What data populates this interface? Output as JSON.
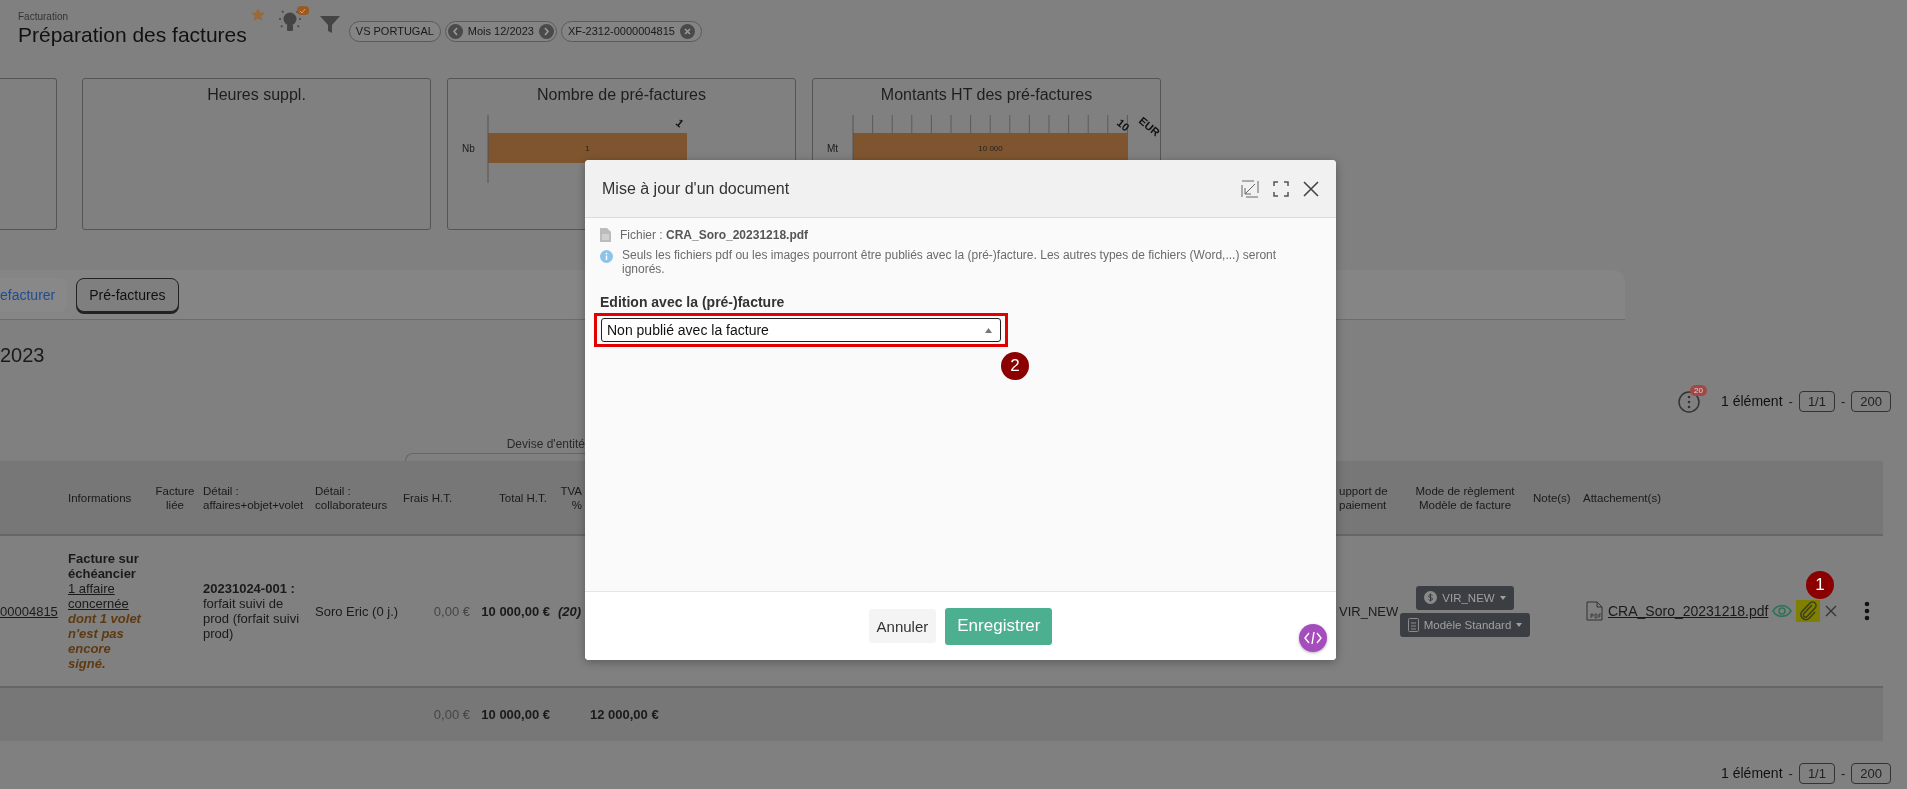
{
  "header": {
    "breadcrumb": "Facturation",
    "title": "Préparation des factures",
    "favorite": true
  },
  "filters": [
    {
      "kind": "plain",
      "label": "VS PORTUGAL"
    },
    {
      "kind": "period",
      "label": "Mois 12/2023"
    },
    {
      "kind": "removable",
      "label": "XF-2312-0000004815"
    }
  ],
  "kpi_cards": [
    {
      "kind": "blank"
    },
    {
      "kind": "empty",
      "title": "Heures suppl."
    },
    {
      "kind": "chart",
      "title": "Nombre de pré-factures",
      "chart_data": {
        "type": "bar",
        "orientation": "horizontal",
        "categories": [
          "Nb"
        ],
        "series": [
          {
            "color": "#7f552f",
            "values": [
              1
            ]
          }
        ],
        "data_labels": true,
        "annotations": [
          "1"
        ]
      }
    },
    {
      "kind": "chart",
      "title": "Montants HT des pré-factures",
      "chart_data": {
        "type": "bar",
        "orientation": "horizontal",
        "categories": [
          "Mt"
        ],
        "series": [
          {
            "color": "#7f552f",
            "values": [
              10000
            ]
          }
        ],
        "data_labels": true,
        "annotations": [
          "10",
          "EUR"
        ]
      }
    }
  ],
  "tabs": [
    {
      "label": "efacturer",
      "selected": false
    },
    {
      "label": "Pré-factures",
      "selected": true
    }
  ],
  "period_title": "2023",
  "pager_top": {
    "notification_count": "20",
    "count": "1 élément",
    "separators": [
      "-",
      "-"
    ],
    "page": "1/1",
    "page_size": "200"
  },
  "currency_label": "Devise d'entité",
  "table": {
    "columns": [
      "Informations",
      "Facture liée",
      "Détail : affaires+objet+volet",
      "Détail : collaborateurs",
      "Frais H.T.",
      "Total H.T.",
      "TVA %",
      "upport de paiement",
      "Mode de règlement Modèle de facture",
      "Note(s)",
      "Attachement(s)"
    ],
    "rows": [
      {
        "reference": "00004815",
        "info_title": "Facture sur échéancier",
        "info_link": "1 affaire concernée",
        "info_warning": "dont 1 volet n'est pas encore signé.",
        "detail": "**20231024-001 :** forfait suivi de prod (forfait suivi prod)",
        "staff": "Soro Eric (0 j.)",
        "fees": "0,00 €",
        "total": "10 000,00 €",
        "vat": "(20)",
        "payment_support": "VIR_NEW",
        "payment_mode": "VIR_NEW",
        "invoice_template": "Modèle Standard",
        "attachment": {
          "file": "CRA_Soro_20231218.pdf",
          "highlighted": true
        }
      }
    ],
    "totals": {
      "fees": "0,00 €",
      "total": "10 000,00 €",
      "total_ttc": "12 000,00 €"
    }
  },
  "pager_bottom": {
    "count": "1 élément",
    "separators": [
      "-",
      "-"
    ],
    "page": "1/1",
    "page_size": "200"
  },
  "modal": {
    "title": "Mise à jour d'un document",
    "file": "Fichier : **CRA_Soro_20231218.pdf**",
    "info": "Seuls les fichiers pdf ou les images pourront être publiés avec la (pré-)facture. Les autres types de fichiers (Word,...) seront ignorés.",
    "field_label": "Edition avec la (pré-)facture",
    "select_value": "Non publié avec la facture",
    "highlighted": true,
    "buttons": [
      {
        "kind": "secondary",
        "label": "Annuler"
      },
      {
        "kind": "primary",
        "label": "Enregistrer"
      }
    ]
  },
  "callouts": [
    {
      "label": "1"
    },
    {
      "label": "2"
    }
  ]
}
